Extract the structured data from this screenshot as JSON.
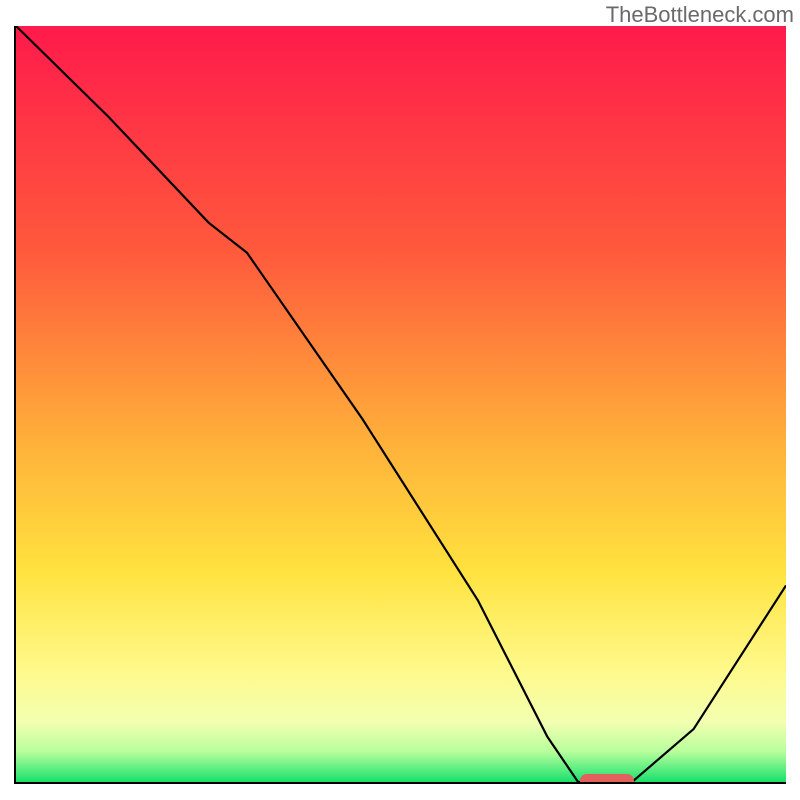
{
  "watermark": "TheBottleneck.com",
  "chart_data": {
    "type": "line",
    "title": "",
    "xlabel": "",
    "ylabel": "",
    "xlim": [
      0,
      100
    ],
    "ylim": [
      0,
      100
    ],
    "gradient_stops": [
      {
        "offset": 0,
        "color": "#ff1a4b"
      },
      {
        "offset": 30,
        "color": "#ff5a3c"
      },
      {
        "offset": 55,
        "color": "#ffb03a"
      },
      {
        "offset": 72,
        "color": "#ffe23e"
      },
      {
        "offset": 85,
        "color": "#fff98a"
      },
      {
        "offset": 92,
        "color": "#f3ffb0"
      },
      {
        "offset": 96,
        "color": "#b7ff9c"
      },
      {
        "offset": 100,
        "color": "#18e06d"
      }
    ],
    "series": [
      {
        "name": "bottleneck-curve",
        "x": [
          0,
          12,
          25,
          30,
          45,
          60,
          69,
          73,
          80,
          88,
          100
        ],
        "y": [
          100,
          88,
          74,
          70,
          48,
          24,
          6,
          0,
          0,
          7,
          26
        ]
      }
    ],
    "optimal_marker": {
      "x_start": 73,
      "x_end": 80,
      "y": 0
    },
    "colors": {
      "curve": "#000000",
      "marker": "#e3605d",
      "axis": "#000000"
    }
  }
}
